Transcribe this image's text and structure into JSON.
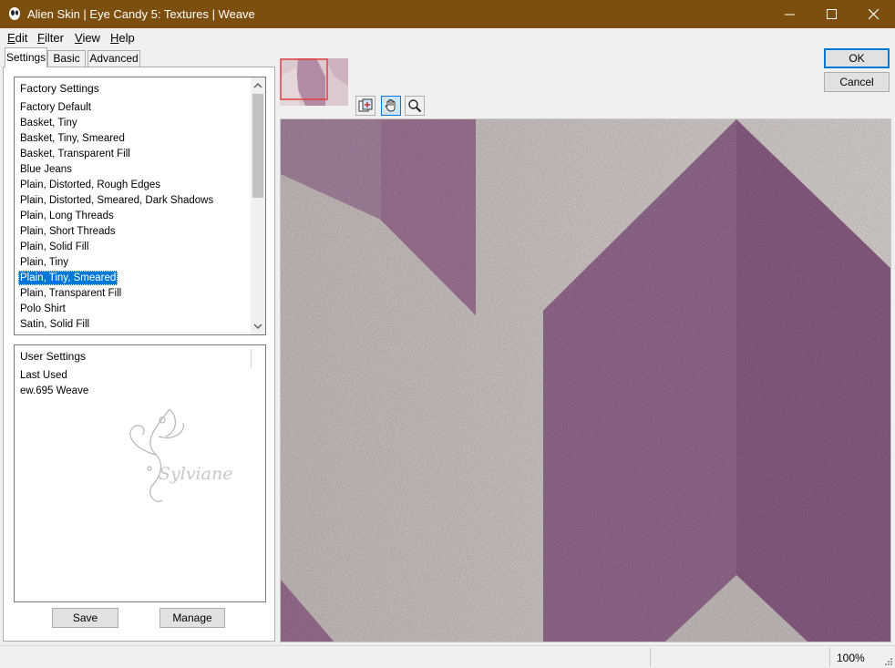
{
  "window": {
    "title": "Alien Skin | Eye Candy 5: Textures | Weave"
  },
  "menu": {
    "items": [
      {
        "label": "Edit",
        "accel": "E",
        "rest": "dit"
      },
      {
        "label": "Filter",
        "accel": "F",
        "rest": "ilter"
      },
      {
        "label": "View",
        "accel": "V",
        "rest": "iew"
      },
      {
        "label": "Help",
        "accel": "H",
        "rest": "elp"
      }
    ]
  },
  "tabs": {
    "settings": "Settings",
    "basic": "Basic",
    "advanced": "Advanced",
    "active": "Settings"
  },
  "factory": {
    "header": "Factory Settings",
    "items": [
      "Factory Default",
      "Basket, Tiny",
      "Basket, Tiny, Smeared",
      "Basket, Transparent Fill",
      "Blue Jeans",
      "Plain, Distorted, Rough Edges",
      "Plain, Distorted, Smeared, Dark Shadows",
      "Plain, Long Threads",
      "Plain, Short Threads",
      "Plain, Solid Fill",
      "Plain, Tiny",
      "Plain, Tiny, Smeared",
      "Plain, Transparent Fill",
      "Polo Shirt",
      "Satin, Solid Fill"
    ],
    "selected": "Plain, Tiny, Smeared"
  },
  "user": {
    "header": "User Settings",
    "items": [
      "Last Used",
      "ew.695 Weave"
    ],
    "watermark_text": "Sylviane"
  },
  "buttons": {
    "save": "Save",
    "manage": "Manage",
    "ok": "OK",
    "cancel": "Cancel"
  },
  "tools": {
    "icons": [
      "preview-toggle-icon",
      "hand-icon",
      "zoom-icon"
    ],
    "active": "hand-icon"
  },
  "status": {
    "zoom": "100%"
  },
  "colors": {
    "titlebar": "#7d4f0e",
    "selection": "#0078d7",
    "weave_light": "#d9d2d1",
    "weave_dark": "#8e5f86"
  }
}
